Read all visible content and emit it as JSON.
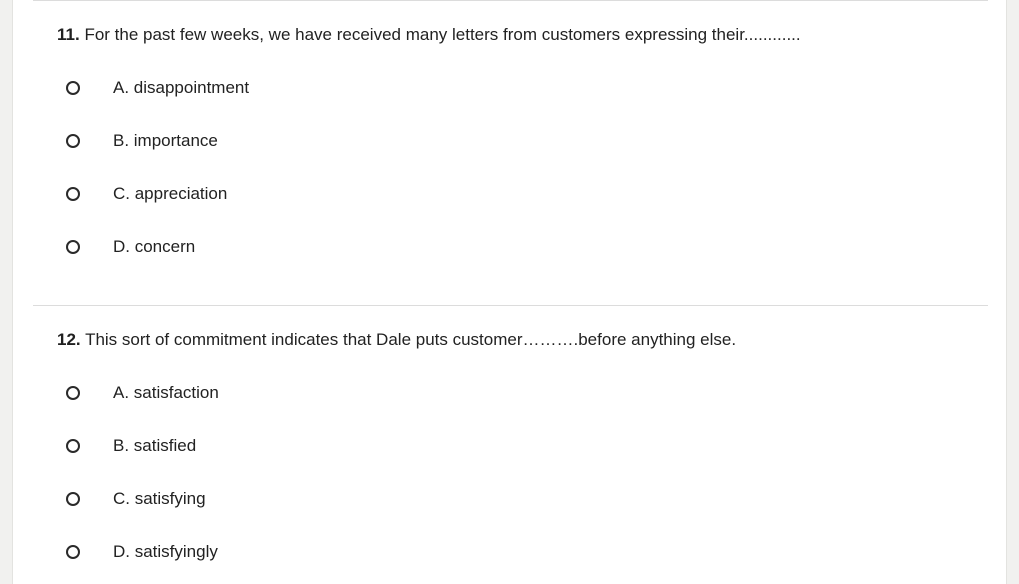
{
  "questions": [
    {
      "number": "11.",
      "text": "For the past few weeks, we have received many letters from customers expressing their............",
      "options": [
        {
          "label": "A. disappointment"
        },
        {
          "label": "B. importance"
        },
        {
          "label": "C. appreciation"
        },
        {
          "label": "D. concern"
        }
      ]
    },
    {
      "number": "12.",
      "text": "This sort of commitment indicates that Dale puts customer……….before anything else.",
      "options": [
        {
          "label": "A. satisfaction"
        },
        {
          "label": "B. satisfied"
        },
        {
          "label": "C. satisfying"
        },
        {
          "label": "D. satisfyingly"
        }
      ]
    }
  ],
  "icons": {
    "radio": "radio-unchecked-icon"
  },
  "colors": {
    "page_background": "#f1f1ef",
    "panel_background": "#ffffff",
    "text": "#222222",
    "divider": "#dcdcdc"
  }
}
